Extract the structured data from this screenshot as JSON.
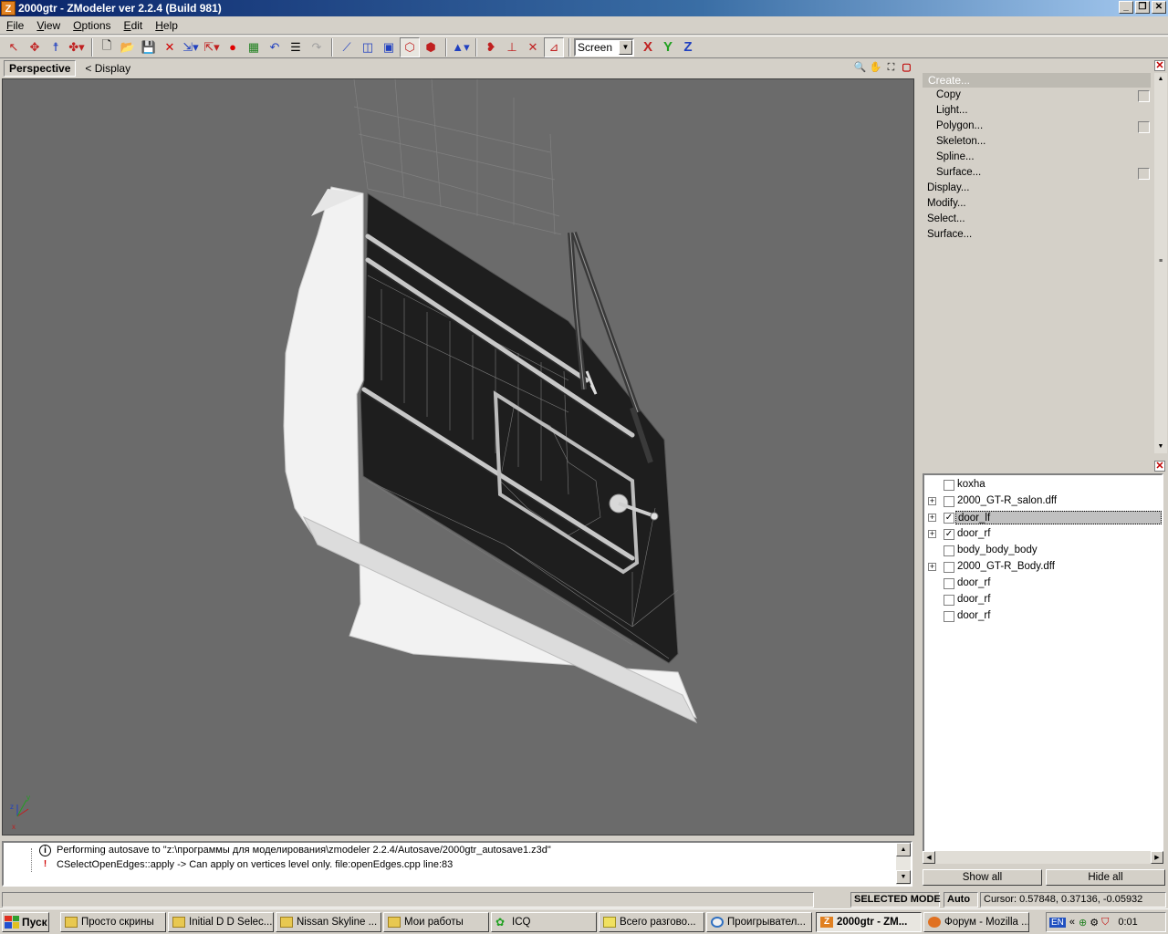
{
  "window": {
    "title": "2000gtr - ZModeler ver 2.2.4 (Build 981)"
  },
  "menu": [
    "File",
    "View",
    "Options",
    "Edit",
    "Help"
  ],
  "toolbar": {
    "coord_mode": "Screen",
    "axis_x": "X",
    "axis_y": "Y",
    "axis_z": "Z"
  },
  "viewport": {
    "tab": "Perspective",
    "display_label": "< Display"
  },
  "create_panel": {
    "header": "Create...",
    "items": [
      "Copy",
      "Light...",
      "Polygon...",
      "Skeleton...",
      "Spline...",
      "Surface..."
    ],
    "groups": [
      "Display...",
      "Modify...",
      "Select...",
      "Surface..."
    ]
  },
  "tree": {
    "items": [
      {
        "label": "koxha",
        "expandable": false,
        "checked": false,
        "selected": false
      },
      {
        "label": "2000_GT-R_salon.dff",
        "expandable": true,
        "checked": false,
        "selected": false
      },
      {
        "label": "door_lf",
        "expandable": true,
        "checked": true,
        "selected": true
      },
      {
        "label": "door_rf",
        "expandable": true,
        "checked": true,
        "selected": false
      },
      {
        "label": "body_body_body",
        "expandable": false,
        "checked": false,
        "selected": false
      },
      {
        "label": "2000_GT-R_Body.dff",
        "expandable": true,
        "checked": false,
        "selected": false
      },
      {
        "label": "door_rf",
        "expandable": false,
        "checked": false,
        "selected": false
      },
      {
        "label": "door_rf",
        "expandable": false,
        "checked": false,
        "selected": false
      },
      {
        "label": "door_rf",
        "expandable": false,
        "checked": false,
        "selected": false
      }
    ],
    "show_all": "Show all",
    "hide_all": "Hide all"
  },
  "log": [
    "Performing autosave to \"z:\\программы для моделирования\\zmodeler 2.2.4/Autosave/2000gtr_autosave1.z3d\"",
    "CSelectOpenEdges::apply -> Can apply on vertices level only. file:openEdges.cpp line:83"
  ],
  "status": {
    "mode": "SELECTED MODE",
    "auto": "Auto",
    "cursor": "Cursor: 0.57848, 0.37136, -0.05932"
  },
  "taskbar": {
    "start": "Пуск",
    "tasks": [
      "Просто скрины",
      "Initial D D Selec...",
      "Nissan Skyline ...",
      "Мои работы",
      "ICQ",
      "Всего разгово...",
      "Проигрывател...",
      "2000gtr - ZM...",
      "Форум - Mozilla ..."
    ],
    "lang": "EN",
    "clock": "0:01"
  },
  "colors": {
    "viewport_bg": "#6b6b6b",
    "title_bar": "#0a246a",
    "face": "#d4d0c8",
    "door_panel": "#1e1e1e",
    "door_frame": "#f4f4f4"
  }
}
